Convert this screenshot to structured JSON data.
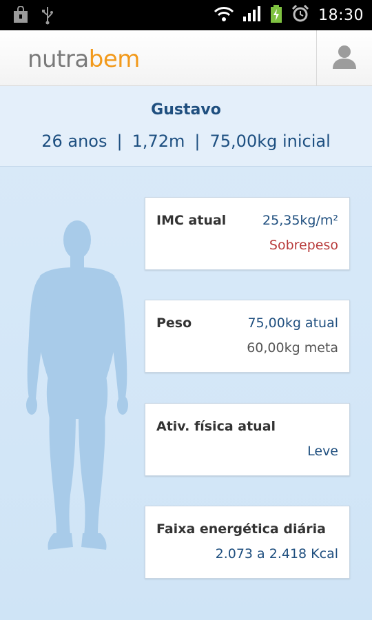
{
  "status_bar": {
    "time": "18:30",
    "icons": [
      "shopping-bag-icon",
      "usb-icon",
      "wifi-icon",
      "signal-icon",
      "battery-charging-icon",
      "alarm-clock-icon"
    ]
  },
  "app_bar": {
    "logo_part1": "nutra",
    "logo_part2": "bem",
    "profile_icon": "user-icon"
  },
  "user": {
    "name": "Gustavo",
    "age": "26 anos",
    "height": "1,72m",
    "initial_weight": "75,00kg inicial",
    "separator": "|"
  },
  "cards": {
    "imc": {
      "label": "IMC atual",
      "value": "25,35kg/m²",
      "status": "Sobrepeso"
    },
    "peso": {
      "label": "Peso",
      "current": "75,00kg atual",
      "goal": "60,00kg meta"
    },
    "atividade": {
      "label": "Ativ. física atual",
      "value": "Leve"
    },
    "energia": {
      "label": "Faixa energética diária",
      "value": "2.073 a 2.418 Kcal"
    }
  },
  "colors": {
    "accent_blue": "#1f4f7f",
    "logo_orange": "#f29a1c",
    "warning_red": "#b83b3b",
    "background": "#d6e8f8",
    "silhouette": "#a8cbe9"
  }
}
